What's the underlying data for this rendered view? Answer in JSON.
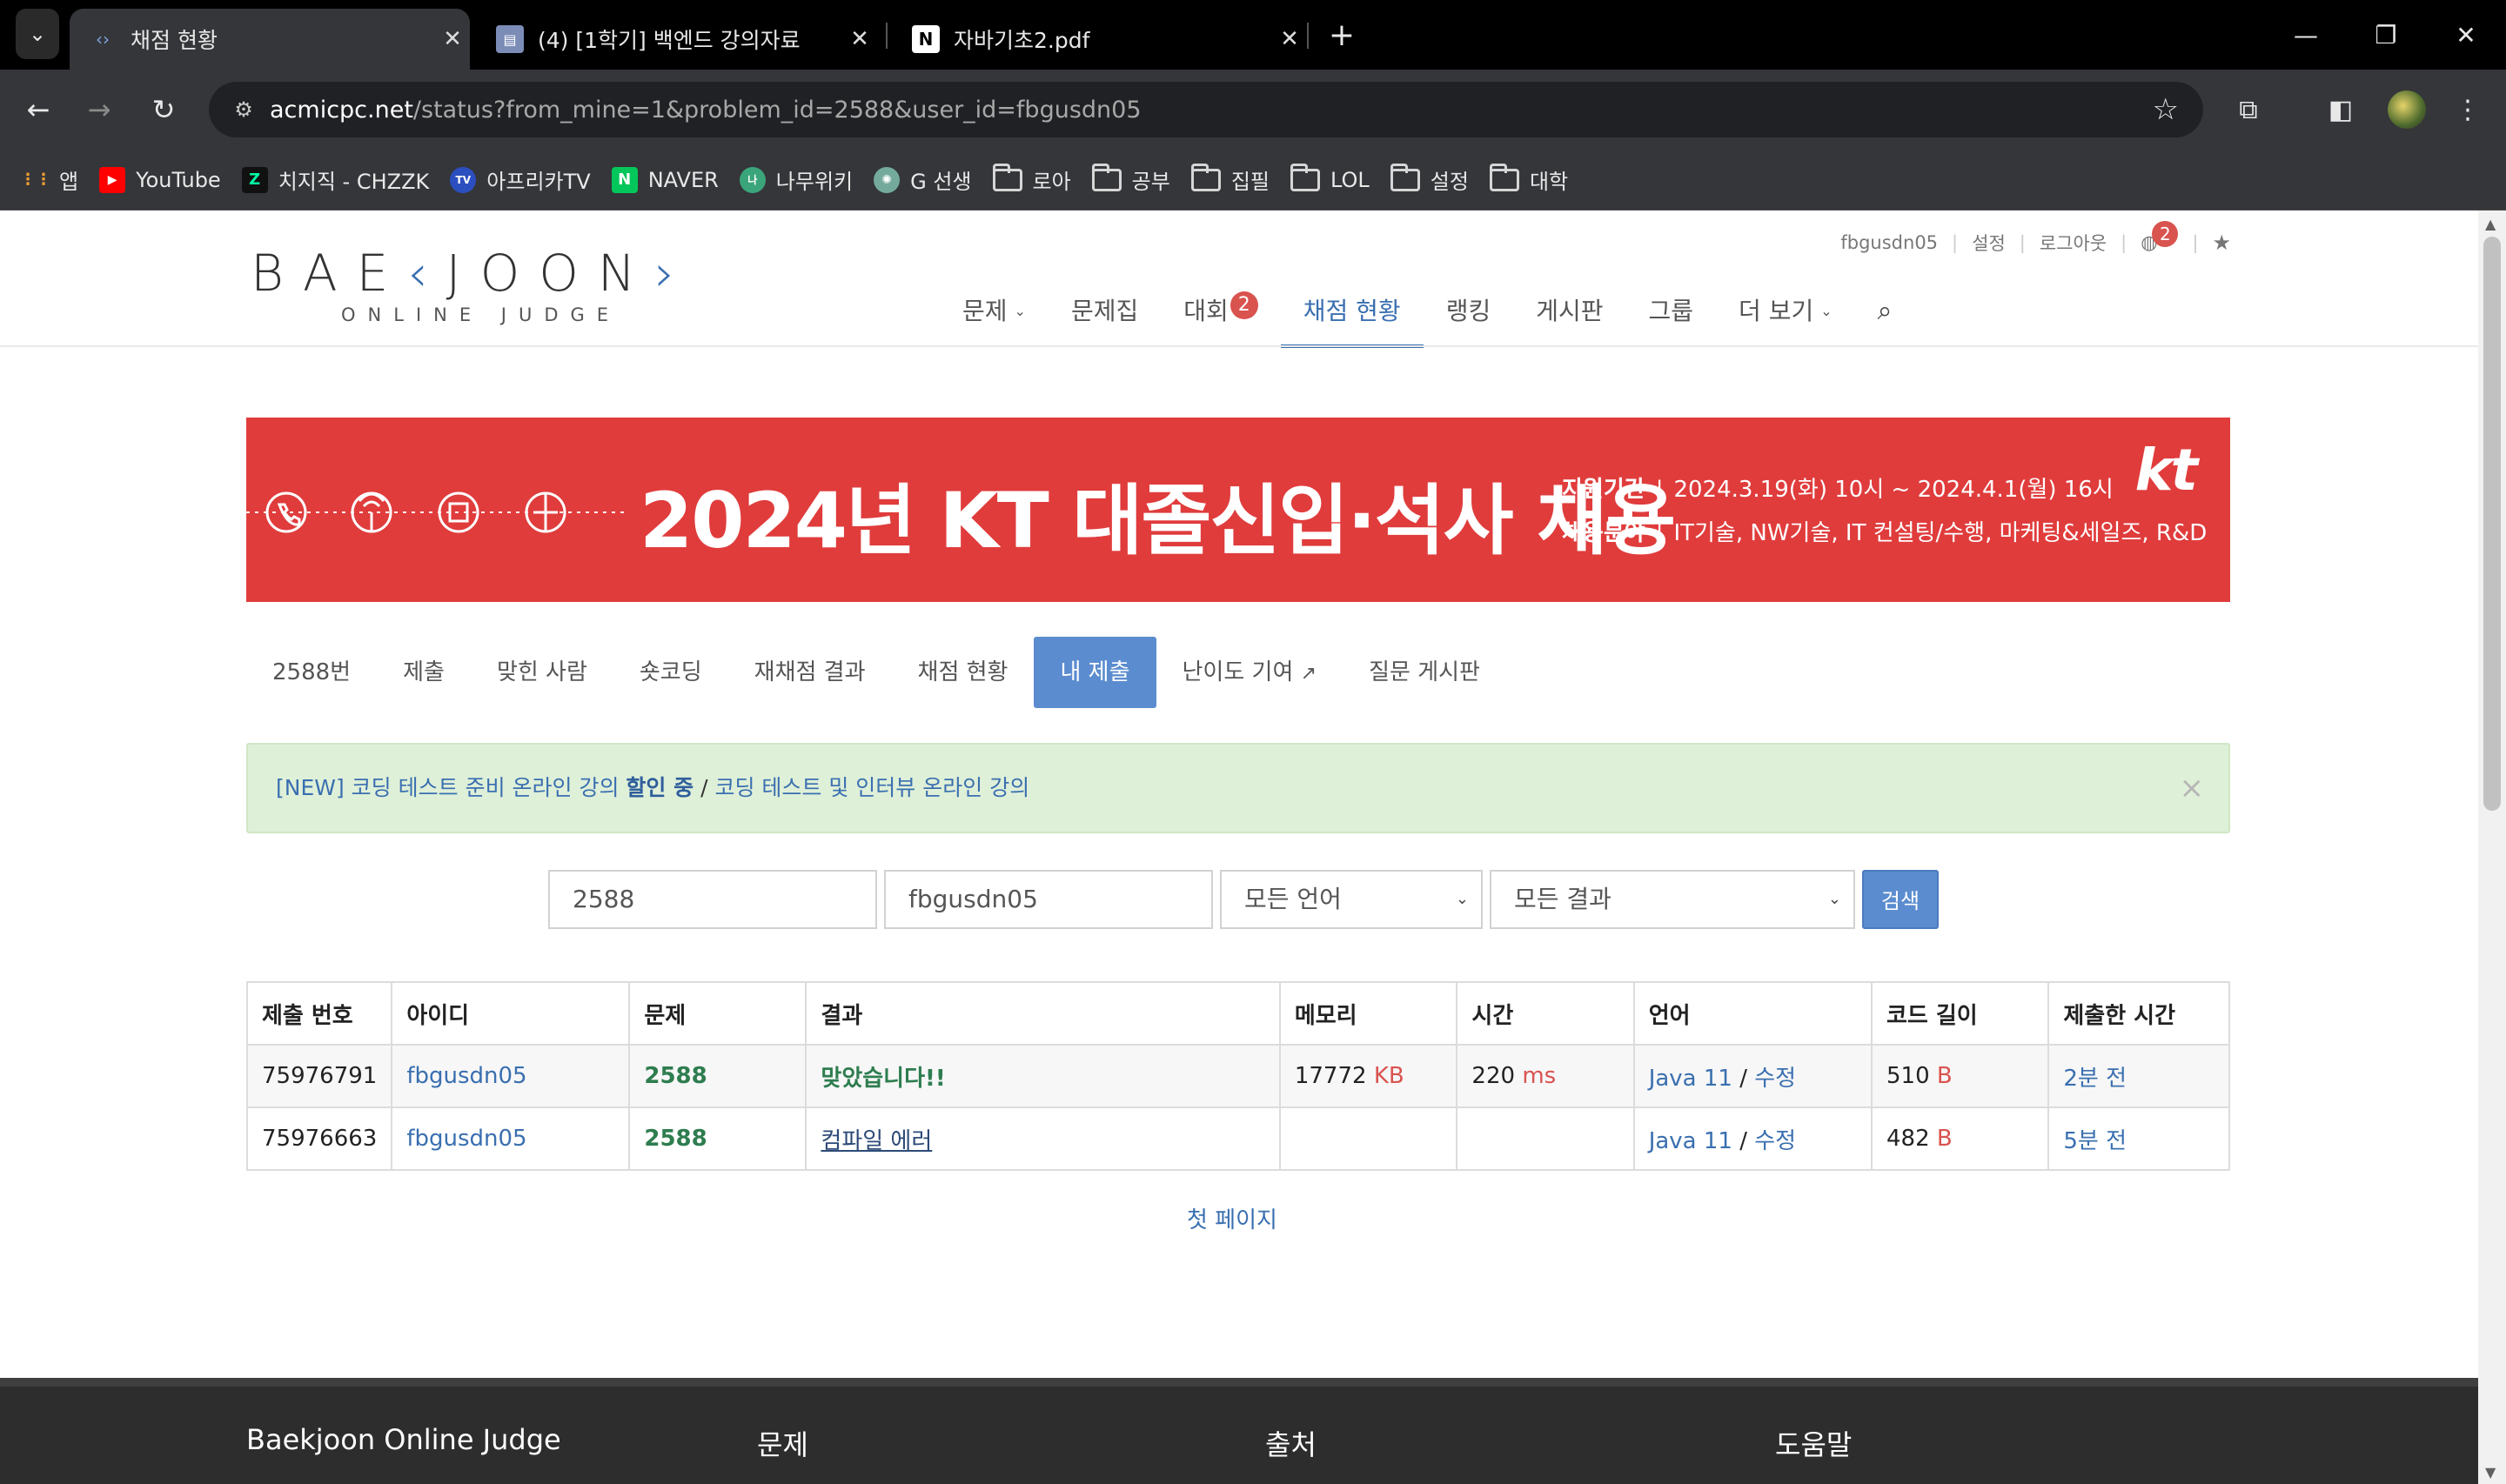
{
  "browser": {
    "tabs": [
      {
        "title": "채점 현황",
        "active": true
      },
      {
        "title": "(4) [1학기] 백엔드 강의자료",
        "active": false
      },
      {
        "title": "자바기초2.pdf",
        "active": false
      }
    ],
    "url_host": "acmicpc.net",
    "url_path": "/status?from_mine=1&problem_id=2588&user_id=fbgusdn05",
    "bookmarks": [
      "앱",
      "YouTube",
      "치지직 - CHZZK",
      "아프리카TV",
      "NAVER",
      "나무위키",
      "G 선생",
      "로아",
      "공부",
      "집필",
      "LOL",
      "설정",
      "대학"
    ]
  },
  "site": {
    "logo_text_a": "BAE",
    "logo_text_b": "JOON",
    "logo_sub": "ONLINE JUDGE",
    "topmeta": {
      "user": "fbgusdn05",
      "settings": "설정",
      "logout": "로그아웃",
      "notif_count": "2"
    },
    "nav": {
      "problems": "문제",
      "workbook": "문제집",
      "contest": "대회",
      "contest_badge": "2",
      "status": "채점 현황",
      "ranking": "랭킹",
      "board": "게시판",
      "group": "그룹",
      "more": "더 보기"
    },
    "banner": {
      "headline": "2024년 KT 대졸신입·석사 채용",
      "line1_label": "지원기간",
      "line1_text": "2024.3.19(화) 10시 ~ 2024.4.1(월) 16시",
      "line2_label": "채용분야",
      "line2_text": "IT기술, NW기술, IT 컨설팅/수행, 마케팅&세일즈, R&D",
      "brand": "kt"
    },
    "subnav": [
      "2588번",
      "제출",
      "맞힌 사람",
      "숏코딩",
      "재채점 결과",
      "채점 현황",
      "내 제출",
      "난이도 기여",
      "질문 게시판"
    ],
    "alert": {
      "part1": "[NEW] 코딩 테스트 준비 온라인 강의 ",
      "bold": "할인 중",
      "sep": " / ",
      "part2": "코딩 테스트 및 인터뷰 온라인 강의"
    },
    "search": {
      "problem_id": "2588",
      "user_id": "fbgusdn05",
      "language": "모든 언어",
      "result": "모든 결과",
      "button": "검색"
    },
    "table": {
      "headers": [
        "제출 번호",
        "아이디",
        "문제",
        "결과",
        "메모리",
        "시간",
        "언어",
        "코드 길이",
        "제출한 시간"
      ],
      "rows": [
        {
          "id": "75976791",
          "user": "fbgusdn05",
          "problem": "2588",
          "result": "맞았습니다!!",
          "memory": "17772",
          "memory_unit": "KB",
          "time": "220",
          "time_unit": "ms",
          "language": "Java 11",
          "edit": "수정",
          "length": "510",
          "length_unit": "B",
          "submitted": "2분 전"
        },
        {
          "id": "75976663",
          "user": "fbgusdn05",
          "problem": "2588",
          "result": "컴파일 에러",
          "memory": "",
          "memory_unit": "",
          "time": "",
          "time_unit": "",
          "language": "Java 11",
          "edit": "수정",
          "length": "482",
          "length_unit": "B",
          "submitted": "5분 전"
        }
      ]
    },
    "pager": "첫 페이지",
    "footer": [
      "Baekjoon Online Judge",
      "문제",
      "출처",
      "도움말"
    ]
  }
}
